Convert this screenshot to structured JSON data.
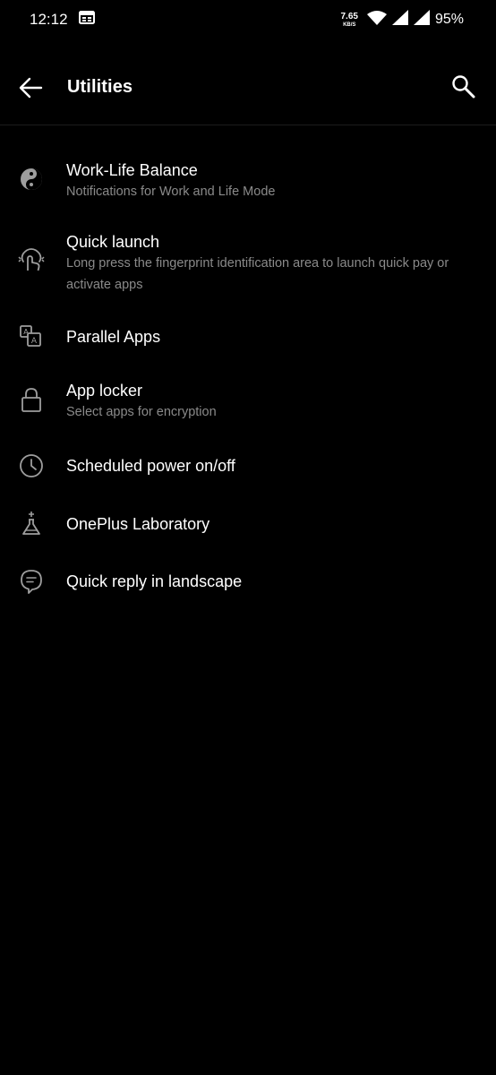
{
  "status_bar": {
    "time": "12:12",
    "speed_value": "7.65",
    "speed_unit": "KB/S",
    "battery": "95%"
  },
  "app_bar": {
    "title": "Utilities"
  },
  "items": [
    {
      "title": "Work-Life Balance",
      "subtitle": "Notifications for Work and Life Mode",
      "icon": "yin-yang-icon"
    },
    {
      "title": "Quick launch",
      "subtitle": "Long press the fingerprint identification area to launch quick pay or activate apps",
      "icon": "fingerprint-touch-icon"
    },
    {
      "title": "Parallel Apps",
      "subtitle": "",
      "icon": "parallel-apps-icon"
    },
    {
      "title": "App locker",
      "subtitle": "Select apps for encryption",
      "icon": "lock-icon"
    },
    {
      "title": "Scheduled power on/off",
      "subtitle": "",
      "icon": "clock-icon"
    },
    {
      "title": "OnePlus Laboratory",
      "subtitle": "",
      "icon": "flask-icon"
    },
    {
      "title": "Quick reply in landscape",
      "subtitle": "",
      "icon": "chat-bubble-icon"
    }
  ]
}
